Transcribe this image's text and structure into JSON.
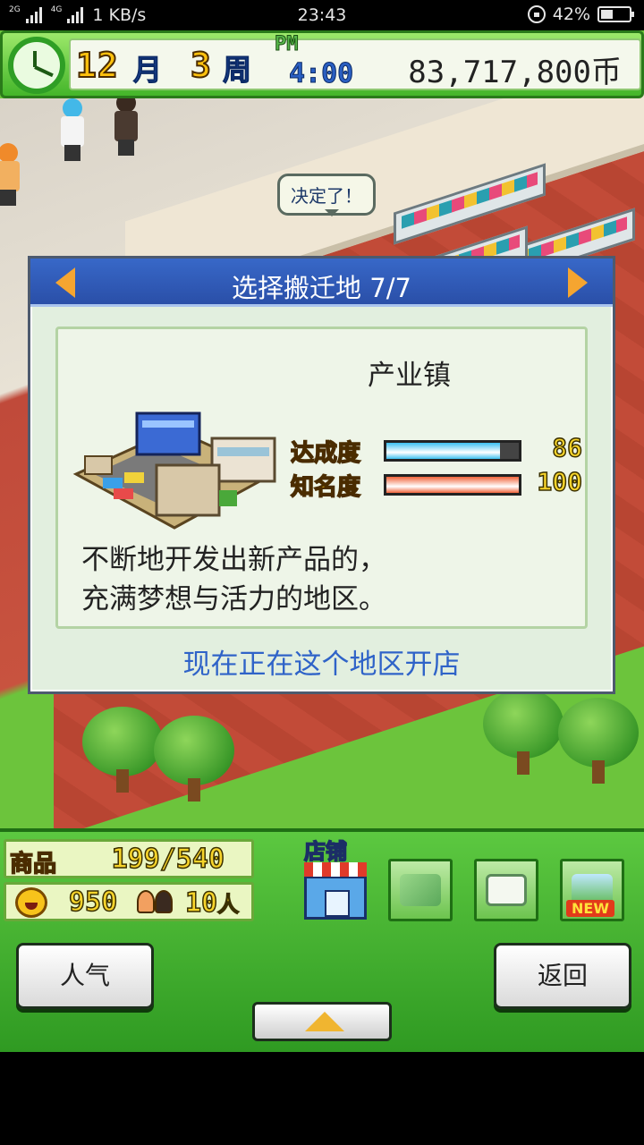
{
  "status_bar": {
    "network_left": "2G",
    "network_right": "4G",
    "speed": "1 KB/s",
    "time": "23:43",
    "battery": "42%",
    "battery_level": 0.42
  },
  "top_hud": {
    "month": "12",
    "month_label": "月",
    "week": "3",
    "week_label": "周",
    "ampm": "PM",
    "game_time": "4:00",
    "money": "83,717,800币",
    "clock_icon": "clock-icon"
  },
  "scene": {
    "speech_bubble": "决定了！"
  },
  "dialog": {
    "title": "选择搬迁地 7/7",
    "prev_icon": "arrow-left-icon",
    "next_icon": "arrow-right-icon",
    "town_name": "产业镇",
    "stats": [
      {
        "label": "达成度",
        "value": "86",
        "fraction": 0.86,
        "color": "#3cc0f0"
      },
      {
        "label": "知名度",
        "value": "100",
        "fraction": 1.0,
        "color": "#f0643a"
      }
    ],
    "description_line1": "不断地开发出新产品的，",
    "description_line2": "充满梦想与活力的地区。",
    "footer": "现在正在这个地区开店"
  },
  "bottom_hud": {
    "goods_label": "商品",
    "goods_value": "199/540",
    "popularity_value": "950",
    "staff_value": "10",
    "staff_unit": "人",
    "store_label": "店铺",
    "icons": [
      "store-icon",
      "goods-icon",
      "chat-icon",
      "map-icon"
    ],
    "new_badge": "NEW",
    "left_button": "人气",
    "right_button": "返回",
    "up_icon": "chevron-up-icon"
  }
}
